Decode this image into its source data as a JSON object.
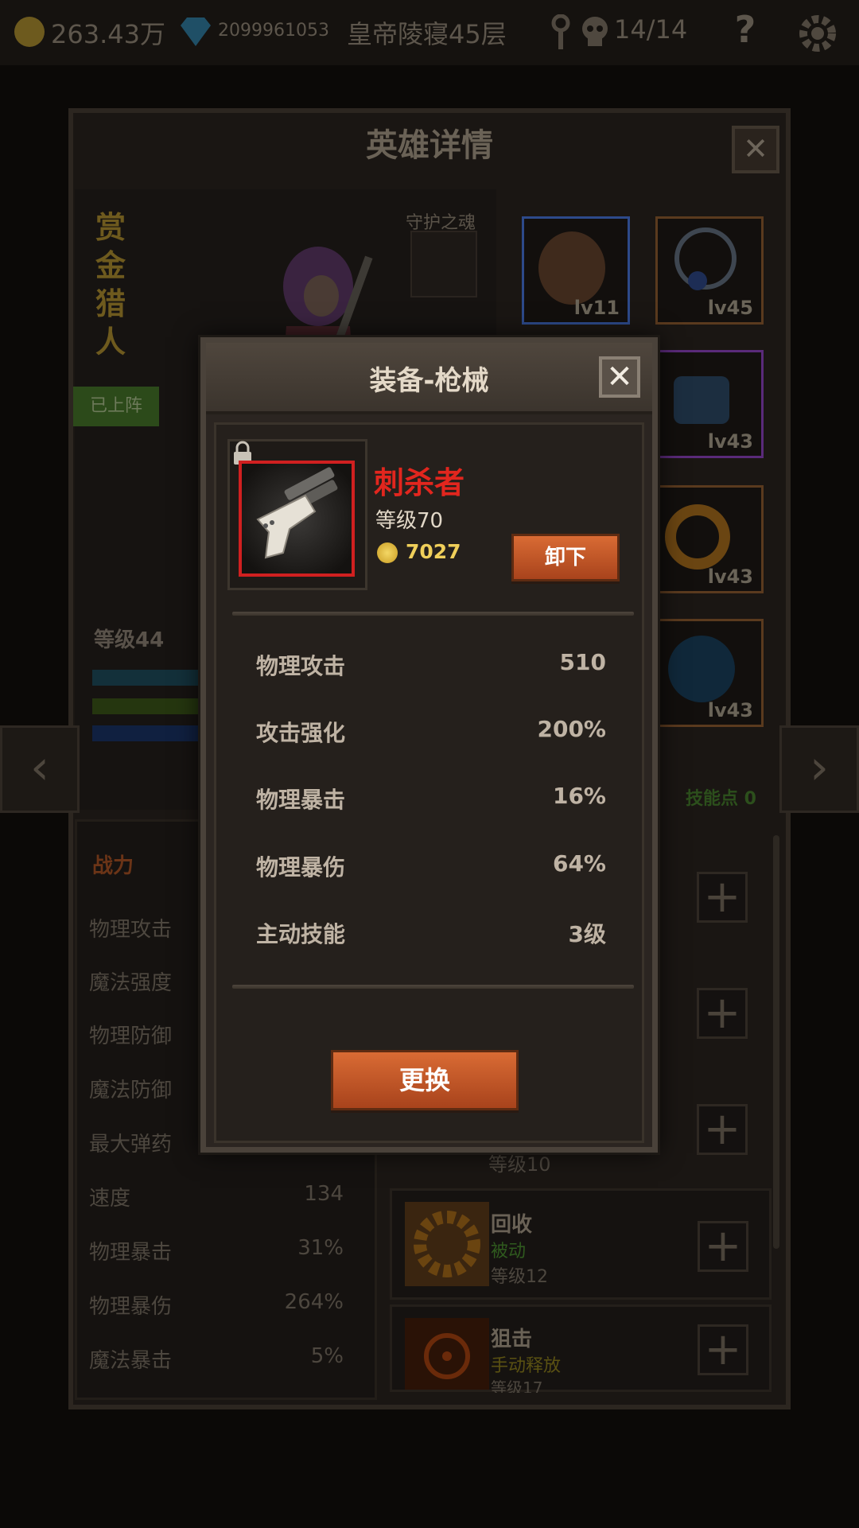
{
  "topbar": {
    "gold": "263.43万",
    "gems": "2099961053",
    "location": "皇帝陵寝45层",
    "stamina": "14/14",
    "help": "?"
  },
  "hero_panel": {
    "title": "英雄详情",
    "close": "✕",
    "hero_name_chars": [
      "赏",
      "金",
      "猎",
      "人"
    ],
    "guardian_label": "守护之魂",
    "deployed_badge": "已上阵",
    "level": "等级44",
    "equipment_slots": [
      {
        "level": "lv11",
        "icon": "helmet-icon",
        "border": "#2d4a8a"
      },
      {
        "level": "lv45",
        "icon": "necklace-icon",
        "border": "#5a3a1e"
      },
      {
        "level": "lv43",
        "icon": "bracer-icon",
        "border": "#5a2a7a"
      },
      {
        "level": "lv43",
        "icon": "ring-icon",
        "border": "#5a3a1e"
      },
      {
        "level": "lv43",
        "icon": "emblem-icon",
        "border": "#5a3a1e"
      }
    ],
    "skill_points": "技能点 0",
    "stats_header": "战力",
    "stats": [
      {
        "name": "物理攻击",
        "value": ""
      },
      {
        "name": "魔法强度",
        "value": ""
      },
      {
        "name": "物理防御",
        "value": ""
      },
      {
        "name": "魔法防御",
        "value": ""
      },
      {
        "name": "最大弹药",
        "value": ""
      },
      {
        "name": "速度",
        "value": "134"
      },
      {
        "name": "物理暴击",
        "value": "31%"
      },
      {
        "name": "物理暴伤",
        "value": "264%"
      },
      {
        "name": "魔法暴击",
        "value": "5%"
      }
    ],
    "skills": [
      {
        "name": "",
        "type": "",
        "level": "等级10"
      },
      {
        "name": "回收",
        "type": "被动",
        "level": "等级12"
      },
      {
        "name": "狙击",
        "type": "手动释放",
        "level": "等级17"
      }
    ]
  },
  "modal": {
    "title": "装备-枪械",
    "close": "✕",
    "item": {
      "name": "刺杀者",
      "level": "等级70",
      "price": "7027",
      "icon": "pistol-icon",
      "locked": true
    },
    "unequip_label": "卸下",
    "stats": [
      {
        "name": "物理攻击",
        "value": "510"
      },
      {
        "name": "攻击强化",
        "value": "200%"
      },
      {
        "name": "物理暴击",
        "value": "16%"
      },
      {
        "name": "物理暴伤",
        "value": "64%"
      },
      {
        "name": "主动技能",
        "value": "3级"
      }
    ],
    "replace_label": "更换"
  },
  "colors": {
    "item_name": "#e2261e",
    "button_orange": "#c2542a",
    "gold_text": "#f0cf5a"
  }
}
